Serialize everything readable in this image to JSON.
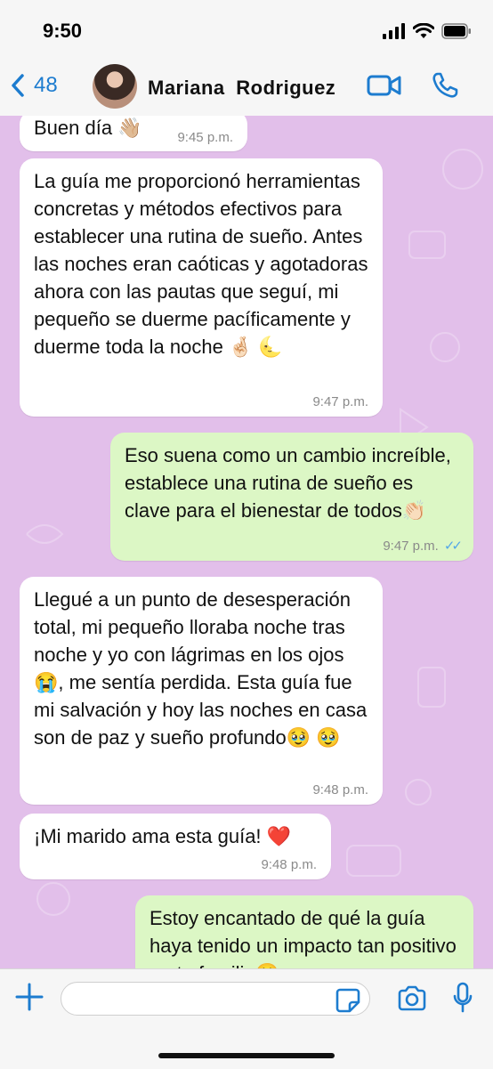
{
  "status_bar": {
    "time": "9:50"
  },
  "header": {
    "back_count": "48",
    "contact_name": "Mariana  Rodriguez"
  },
  "messages": [
    {
      "direction": "incoming",
      "text": "Buen día 👋🏼",
      "time": "9:45 p.m."
    },
    {
      "direction": "incoming",
      "text": "La guía me proporcionó herramientas concretas y métodos efectivos para establecer una rutina de sueño. Antes las noches eran caóticas y agotadoras ahora con las pautas que seguí, mi pequeño se duerme pacíficamente y duerme toda la noche 🤞🏻 🌜",
      "time": "9:47 p.m."
    },
    {
      "direction": "outgoing",
      "text": "Eso suena como un cambio increíble, establece una rutina de sueño es clave para el bienestar de todos👏🏻",
      "time": "9:47 p.m.",
      "ticks": "✓✓"
    },
    {
      "direction": "incoming",
      "text": "Llegué a un punto de desesperación total, mi pequeño lloraba noche tras noche y yo con lágrimas en los ojos😭, me sentía perdida. Esta guía fue mi salvación y hoy las noches en casa son de paz y sueño profundo🥹 🥹",
      "time": "9:48 p.m."
    },
    {
      "direction": "incoming",
      "text": "¡Mi marido ama esta guía! ❤️",
      "time": "9:48 p.m."
    },
    {
      "direction": "outgoing",
      "text": "Estoy encantado de qué la guía haya tenido un impacto tan positivo en tu familia😃",
      "time": ""
    }
  ],
  "composer": {
    "placeholder": ""
  },
  "colors": {
    "accent": "#1d7ccf",
    "chat_background": "#e2bfea",
    "incoming_bubble": "#ffffff",
    "outgoing_bubble": "#dcf7c5",
    "read_ticks": "#53a7e8"
  },
  "icons": [
    "signal-icon",
    "wifi-icon",
    "battery-icon",
    "back-chevron-icon",
    "video-call-icon",
    "phone-icon",
    "plus-icon",
    "sticker-icon",
    "camera-icon",
    "microphone-icon"
  ]
}
